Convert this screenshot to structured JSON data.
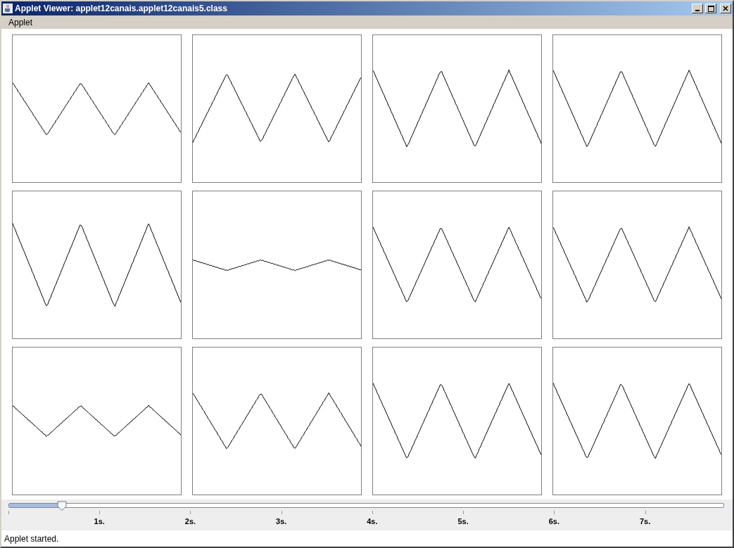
{
  "window": {
    "title": "Applet Viewer: applet12canais.applet12canais5.class"
  },
  "menu_bar": {
    "items": [
      "Applet"
    ]
  },
  "slider": {
    "level": 0.074,
    "tick_labels": [
      "1s.",
      "2s.",
      "3s.",
      "4s.",
      "5s.",
      "6s.",
      "7s."
    ]
  },
  "status_bar": {
    "text": "Applet started."
  }
}
